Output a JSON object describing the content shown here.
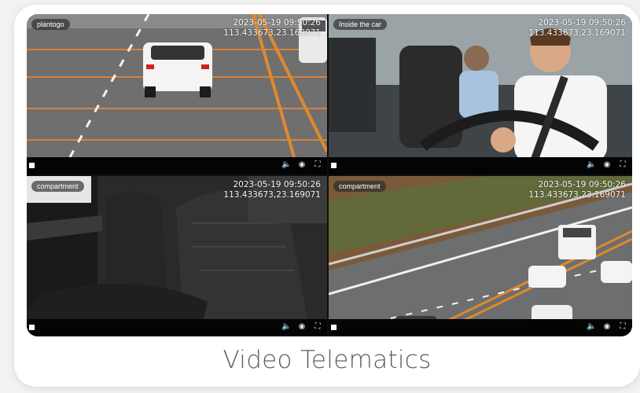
{
  "tiles": [
    {
      "label": "plantogo",
      "timestamp": "2023-05-19 09:50:26",
      "coords": "113.433673,23.169071"
    },
    {
      "label": "Inside the car",
      "timestamp": "2023-05-19 09:50:26",
      "coords": "113.433673,23.169071"
    },
    {
      "label": "compartment",
      "timestamp": "2023-05-19 09:50:26",
      "coords": "113.433673,23.169071"
    },
    {
      "label": "compartment",
      "timestamp": "2023-05-19 09:50:26",
      "coords": "113.433673,23.169071"
    }
  ],
  "controls": {
    "icons": {
      "volume": "🔈",
      "snapshot": "◉",
      "fullscreen": "⛶"
    }
  },
  "caption": "Video Telematics"
}
